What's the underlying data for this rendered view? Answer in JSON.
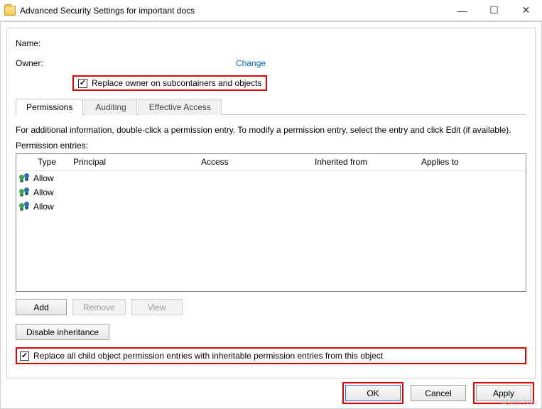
{
  "window": {
    "title": "Advanced Security Settings for important docs"
  },
  "fields": {
    "name_label": "Name:",
    "owner_label": "Owner:",
    "change_link": "Change",
    "replace_owner_label": "Replace owner on subcontainers and objects"
  },
  "tabs": {
    "permissions": "Permissions",
    "auditing": "Auditing",
    "effective": "Effective Access"
  },
  "info_text": "For additional information, double-click a permission entry. To modify a permission entry, select the entry and click Edit (if available).",
  "entries_label": "Permission entries:",
  "grid": {
    "headers": {
      "type": "Type",
      "principal": "Principal",
      "access": "Access",
      "inherited": "Inherited from",
      "applies": "Applies to"
    },
    "rows": [
      {
        "type": "Allow"
      },
      {
        "type": "Allow"
      },
      {
        "type": "Allow"
      }
    ]
  },
  "buttons": {
    "add": "Add",
    "remove": "Remove",
    "view": "View",
    "disable_inheritance": "Disable inheritance",
    "ok": "OK",
    "cancel": "Cancel",
    "apply": "Apply"
  },
  "child_checkbox": "Replace all child object permission entries with inheritable permission entries from this object",
  "watermark": "wsxdn.com"
}
